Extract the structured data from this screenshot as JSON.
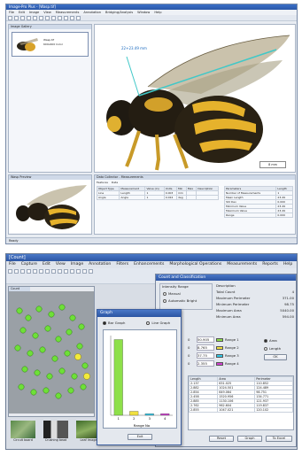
{
  "top_app": {
    "title": "Image-Pro Plus - [Wasp.tif]",
    "menu": [
      "File",
      "Edit",
      "Image",
      "View",
      "Measurements",
      "Annotation",
      "Bridging/Analysis",
      "Window",
      "Help"
    ],
    "thumb_panel_title": "Image Gallery",
    "thumb_caption_1": "Wasp.tif",
    "thumb_caption_2": "600x400 Color",
    "measure_label": "22+23.49 mm",
    "scale_bar_label": "8 mm",
    "preview_title": "Wasp Preview",
    "data_panel_title": "Data Collector - Measurements",
    "data_tabs": [
      "Features",
      "Data"
    ],
    "data_columns": [
      "Object Type",
      "Measurement",
      "Value (in)",
      "Units",
      "Min",
      "Max",
      "Description"
    ],
    "data_rows": [
      [
        "Line",
        "Length",
        "1",
        "0.003",
        "mm",
        "",
        ""
      ],
      [
        "Angle",
        "Angle",
        "1",
        "0.024",
        "deg",
        "",
        ""
      ]
    ],
    "side_columns": [
      "Parameters",
      "Length"
    ],
    "side_rows": [
      [
        "Number of Measurements",
        "1"
      ],
      [
        "Mean Length",
        "23.49"
      ],
      [
        "Std Dev",
        "0.000"
      ],
      [
        "Minimum Value",
        "23.49"
      ],
      [
        "Maximum Value",
        "23.49"
      ],
      [
        "Range",
        "0.000"
      ]
    ],
    "status": "Ready"
  },
  "bottom_app": {
    "title": "[Count]",
    "menu": [
      "File",
      "Capture",
      "Edit",
      "View",
      "Image",
      "Annotation",
      "Filters",
      "Enhancements",
      "Morphological Operations",
      "Measurements",
      "Reports",
      "Help"
    ],
    "count_tab": "Count",
    "strip_labels": [
      "Circuit board",
      "Crushing bead",
      "Leaf Image"
    ],
    "graph_dialog": {
      "title": "Graph",
      "bar_option": "Bar Graph",
      "line_option": "Line Graph",
      "x_label": "Range No",
      "exit_button": "Exit",
      "chart_data": {
        "type": "bar",
        "categories": [
          "1",
          "2",
          "3",
          "4"
        ],
        "values": [
          95,
          5,
          2,
          2
        ],
        "ylim": [
          0,
          100
        ],
        "colors": [
          "#8ee04a",
          "#f0e040",
          "#30c8e8",
          "#d040d0"
        ]
      }
    },
    "count_panel": {
      "title": "Count and Classification",
      "intensity_range_label": "Intensity Range",
      "manual_option": "Manual",
      "automatic_option": "Automatic Bright",
      "description_label": "Description",
      "stats": [
        [
          "Total Count",
          "4"
        ],
        [
          "Maximum Perimeter",
          "371.00"
        ],
        [
          "Minimum Perimeter",
          "98.75"
        ],
        [
          "Maximum Area",
          "5040.00"
        ],
        [
          "Minimum Area",
          "594.00"
        ]
      ],
      "ranges": [
        {
          "min": "0",
          "max": "50.905",
          "label": "Range 1",
          "color": "#8ee04a"
        },
        {
          "min": "0",
          "max": "8.765",
          "label": "Range 2",
          "color": "#f0e040"
        },
        {
          "min": "0",
          "max": "37.75",
          "label": "Range 3",
          "color": "#30c8e8"
        },
        {
          "min": "0",
          "max": "2.355",
          "label": "Range 4",
          "color": "#d040d0"
        }
      ],
      "area_option": "Area",
      "length_option": "Length",
      "ok_button": "OK",
      "table_columns": [
        "Length",
        "Area",
        "Perimeter"
      ],
      "table_rows": [
        [
          "2.137",
          "631.025",
          "110.852"
        ],
        [
          "2.882",
          "1024.501",
          "124.489"
        ],
        [
          "2.854",
          "649.064",
          "98.751"
        ],
        [
          "2.458",
          "1520.956",
          "134.771"
        ],
        [
          "2.885",
          "1130.106",
          "121.937"
        ],
        [
          "2.762",
          "962.604",
          "119.837"
        ],
        [
          "2.855",
          "1047.021",
          "120.102"
        ]
      ],
      "reset_button": "Reset",
      "graph_button": "Graph",
      "excel_button": "To Excel"
    }
  }
}
